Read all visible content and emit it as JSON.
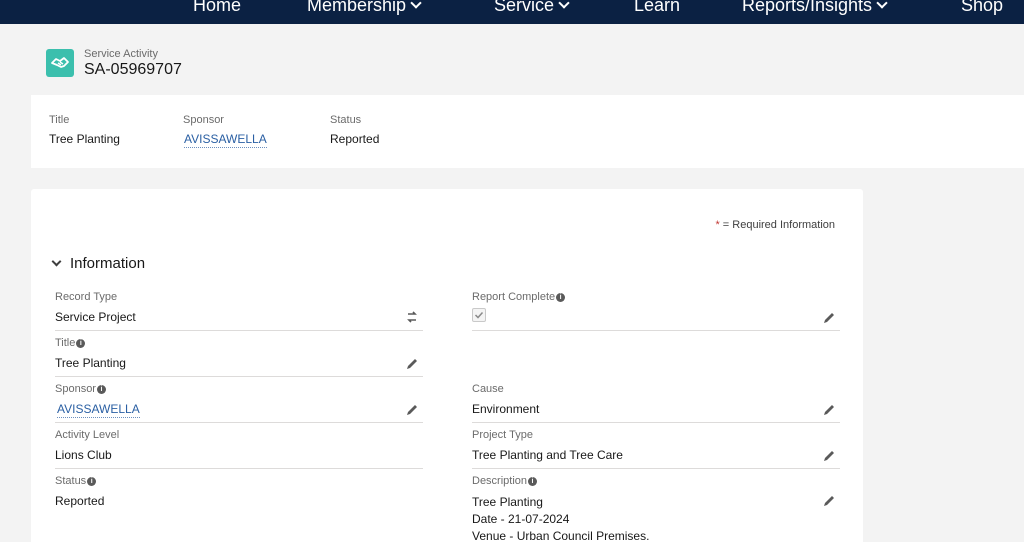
{
  "nav": {
    "items": [
      {
        "label": "Home",
        "dropdown": false
      },
      {
        "label": "Membership",
        "dropdown": true
      },
      {
        "label": "Service",
        "dropdown": true
      },
      {
        "label": "Learn",
        "dropdown": false
      },
      {
        "label": "Reports/Insights",
        "dropdown": true
      },
      {
        "label": "Shop",
        "dropdown": false
      }
    ]
  },
  "header": {
    "object_type": "Service Activity",
    "record_name": "SA-05969707",
    "icon": "handshake-icon",
    "icon_color": "#3bbfad"
  },
  "highlights": {
    "title_label": "Title",
    "title_value": "Tree Planting",
    "sponsor_label": "Sponsor",
    "sponsor_value": "AVISSAWELLA",
    "status_label": "Status",
    "status_value": "Reported"
  },
  "details": {
    "required_marker": "*",
    "required_text": " = Required Information",
    "section_title": "Information",
    "record_type_label": "Record Type",
    "record_type_value": "Service Project",
    "report_complete_label": "Report Complete",
    "report_complete_checked": true,
    "title_label": "Title",
    "title_value": "Tree Planting",
    "sponsor_label": "Sponsor",
    "sponsor_value": "AVISSAWELLA",
    "cause_label": "Cause",
    "cause_value": "Environment",
    "activity_level_label": "Activity Level",
    "activity_level_value": "Lions Club",
    "project_type_label": "Project Type",
    "project_type_value": "Tree Planting and Tree Care",
    "status_label": "Status",
    "status_value": "Reported",
    "description_label": "Description",
    "description_lines": [
      "Tree Planting",
      "Date - 21-07-2024",
      "Venue - Urban Council Premises."
    ]
  },
  "colors": {
    "nav_bg": "#0b2143",
    "link": "#2a5fa3",
    "required_star": "#c23934"
  }
}
